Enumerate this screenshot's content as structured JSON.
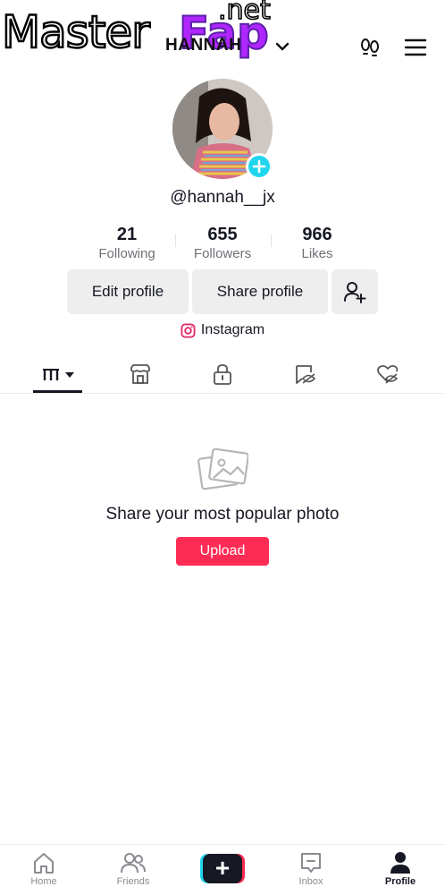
{
  "header": {
    "title": "HANNAH",
    "menu_icon": "hamburger-menu-icon",
    "footprint_icon": "footprint-icon"
  },
  "watermark": {
    "master": "Master",
    "fap": "Fap",
    "net": ".net"
  },
  "profile": {
    "username": "@hannah__jx",
    "stats": [
      {
        "value": "21",
        "label": "Following"
      },
      {
        "value": "655",
        "label": "Followers"
      },
      {
        "value": "966",
        "label": "Likes"
      }
    ],
    "edit_label": "Edit profile",
    "share_label": "Share profile",
    "instagram_label": "Instagram"
  },
  "tabs": [
    "videos-grid",
    "shop",
    "private",
    "reposts",
    "liked"
  ],
  "empty": {
    "title": "Share your most popular photo",
    "upload_label": "Upload"
  },
  "nav": {
    "home": "Home",
    "friends": "Friends",
    "inbox": "Inbox",
    "profile": "Profile"
  },
  "colors": {
    "accent": "#fe2c55",
    "cyan": "#20d5ec",
    "text": "#161823"
  }
}
